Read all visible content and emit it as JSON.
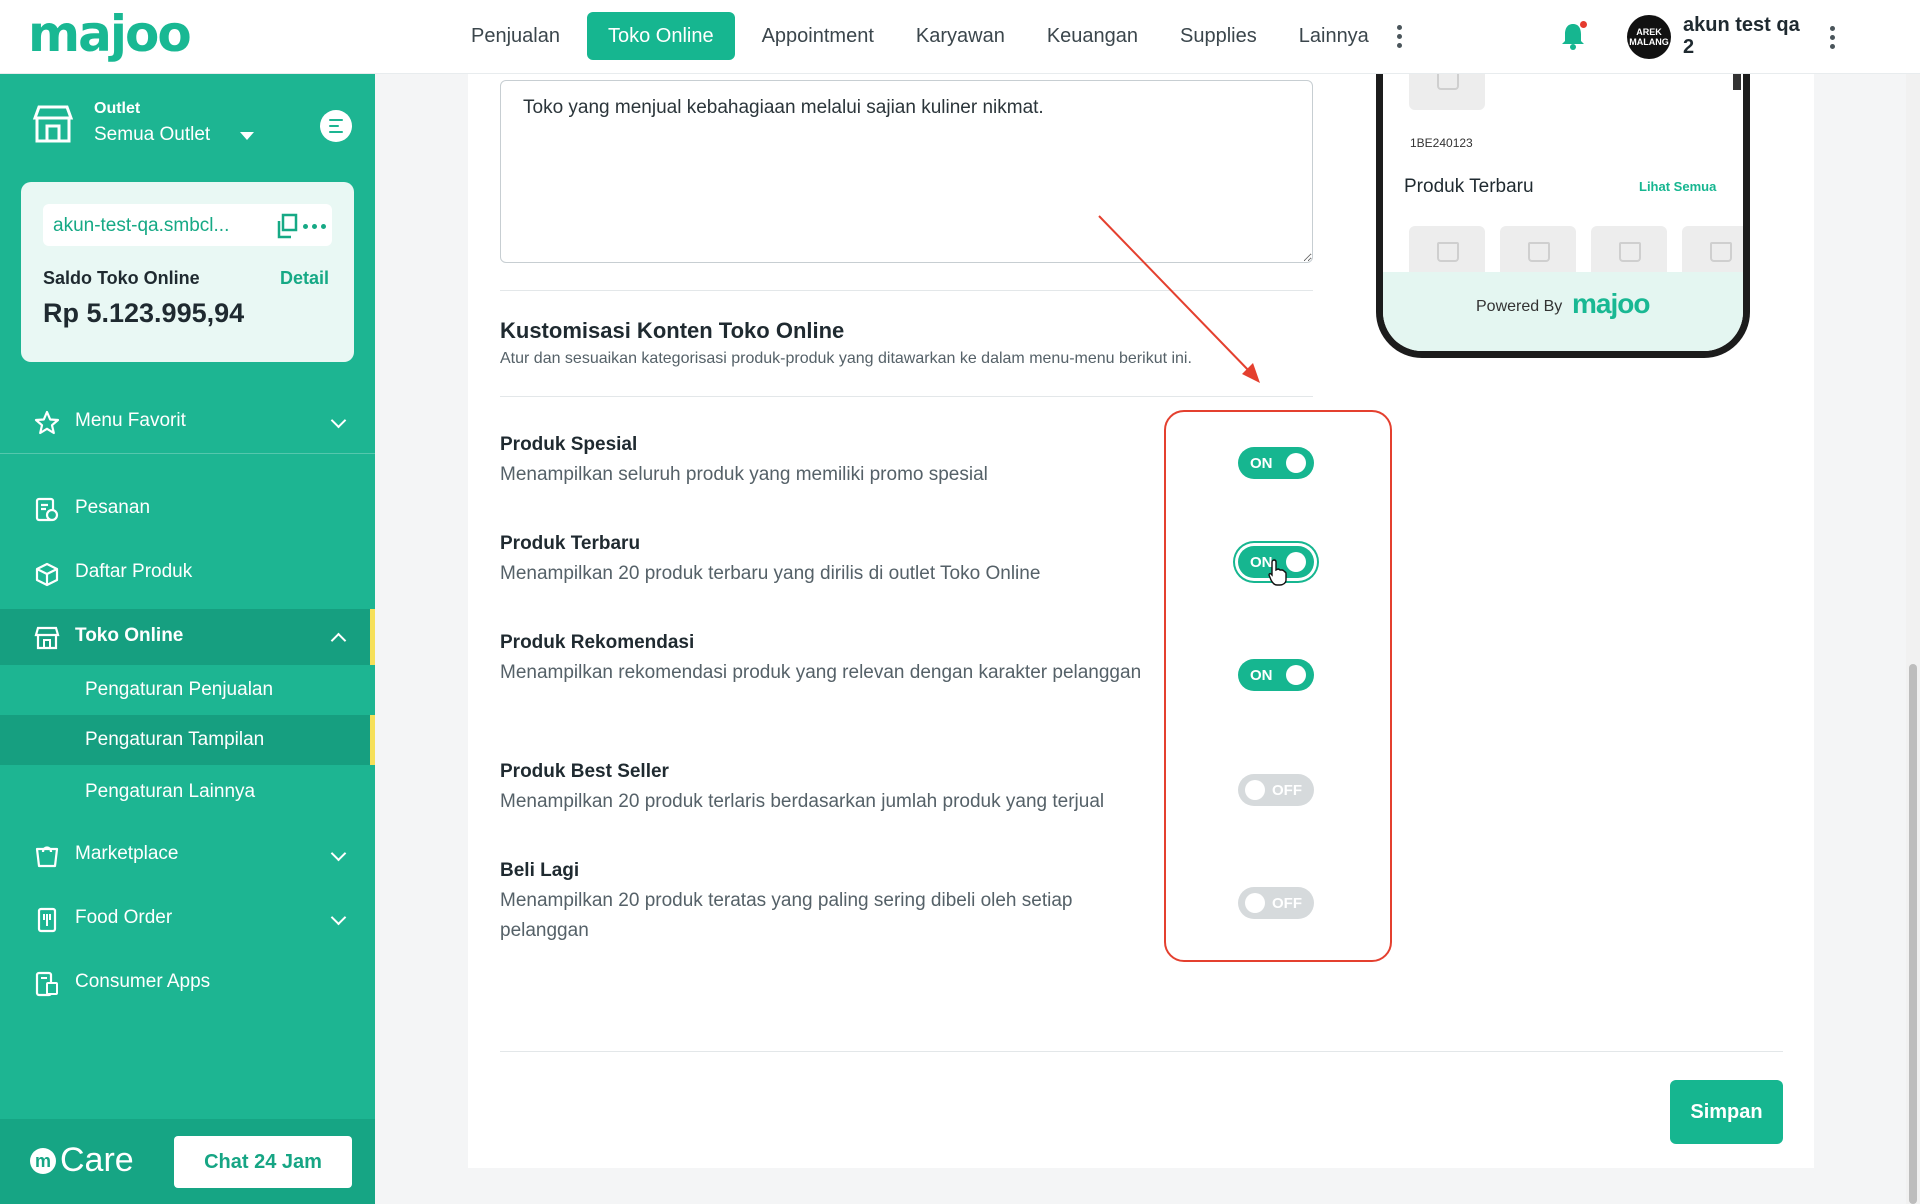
{
  "topbar": {
    "logo": "majoo",
    "nav": [
      "Penjualan",
      "Toko Online",
      "Appointment",
      "Karyawan",
      "Keuangan",
      "Supplies",
      "Lainnya"
    ],
    "active_nav": "Toko Online",
    "avatar_text": "AREK MALANG",
    "user_name": "akun test qa 2"
  },
  "sidebar": {
    "outlet_label": "Outlet",
    "outlet_value": "Semua Outlet",
    "domain": "akun-test-qa.smbcl...",
    "saldo_label": "Saldo Toko Online",
    "saldo_detail": "Detail",
    "saldo_value": "Rp 5.123.995,94",
    "menu_favorit": "Menu Favorit",
    "items": [
      {
        "label": "Pesanan"
      },
      {
        "label": "Daftar Produk"
      },
      {
        "label": "Toko Online"
      },
      {
        "label": "Marketplace"
      },
      {
        "label": "Food Order"
      },
      {
        "label": "Consumer Apps"
      }
    ],
    "sub_items": [
      {
        "label": "Pengaturan Penjualan"
      },
      {
        "label": "Pengaturan Tampilan"
      },
      {
        "label": "Pengaturan Lainnya"
      }
    ],
    "care_label": "Care",
    "chat_button": "Chat 24 Jam"
  },
  "main": {
    "description_value": "Toko yang menjual kebahagiaan melalui sajian kuliner nikmat.",
    "section_title": "Kustomisasi Konten Toko Online",
    "section_subtitle": "Atur dan sesuaikan kategorisasi produk-produk yang ditawarkan ke dalam menu-menu berikut ini.",
    "settings": [
      {
        "title": "Produk Spesial",
        "desc": "Menampilkan seluruh produk yang memiliki promo spesial",
        "state": "ON"
      },
      {
        "title": "Produk Terbaru",
        "desc": "Menampilkan 20 produk terbaru yang dirilis di outlet Toko Online",
        "state": "ON"
      },
      {
        "title": "Produk Rekomendasi",
        "desc": "Menampilkan rekomendasi produk yang relevan dengan karakter pelanggan",
        "state": "ON"
      },
      {
        "title": "Produk Best Seller",
        "desc": "Menampilkan 20 produk terlaris berdasarkan jumlah produk yang terjual",
        "state": "OFF"
      },
      {
        "title": "Beli Lagi",
        "desc": "Menampilkan 20 produk teratas yang paling sering dibeli oleh setiap pelanggan",
        "state": "OFF"
      }
    ],
    "save_button": "Simpan"
  },
  "preview": {
    "code": "1BE240123",
    "section_title": "Produk Terbaru",
    "see_all": "Lihat Semua",
    "powered_by": "Powered By",
    "powered_logo": "majoo"
  },
  "colors": {
    "brand": "#1db592",
    "accent": "#16b690",
    "active_marker": "#f6e05a",
    "annotation": "#e4402f"
  }
}
